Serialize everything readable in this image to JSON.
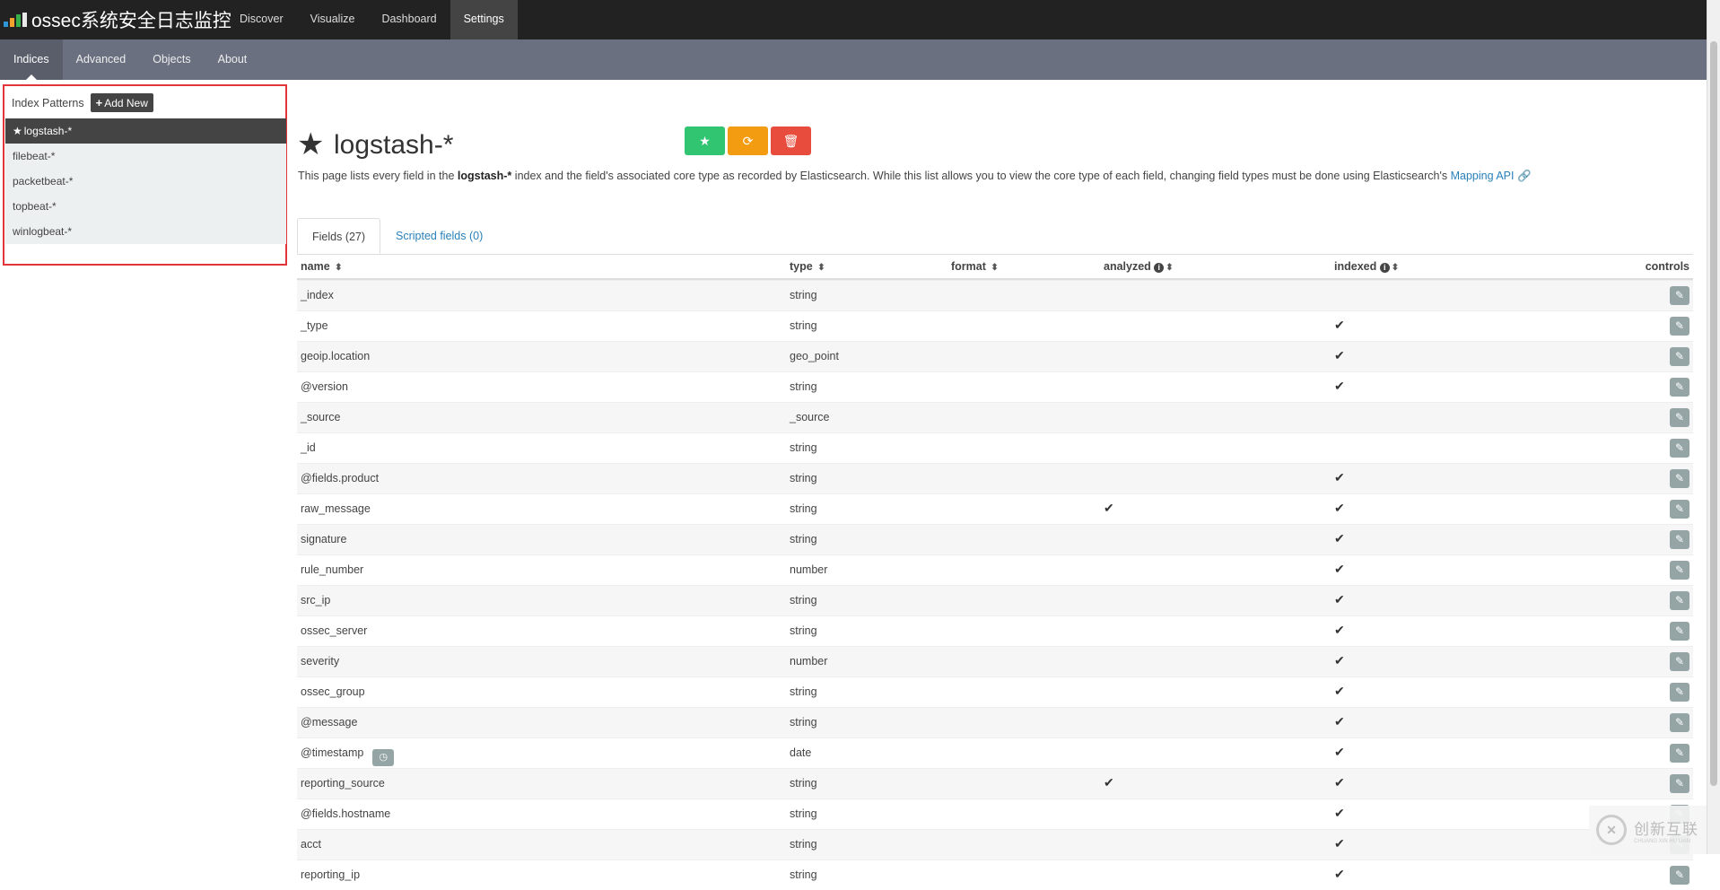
{
  "app": {
    "brand": "ossec系统安全日志监控",
    "logo_colors": [
      "#2f96d6",
      "#f2a22d",
      "#38b04a",
      "#e9e9e9"
    ]
  },
  "top_nav": [
    "Discover",
    "Visualize",
    "Dashboard",
    "Settings"
  ],
  "top_nav_active": "Settings",
  "sub_nav": [
    "Indices",
    "Advanced",
    "Objects",
    "About"
  ],
  "sub_nav_active": "Indices",
  "sidebar": {
    "title": "Index Patterns",
    "add_label": "Add New",
    "items": [
      "logstash-*",
      "filebeat-*",
      "packetbeat-*",
      "topbeat-*",
      "winlogbeat-*"
    ],
    "active_index": 0
  },
  "page": {
    "title": "logstash-*",
    "actions": [
      {
        "icon": "star-icon",
        "color": "#31c471"
      },
      {
        "icon": "refresh-icon",
        "color": "#f39c12"
      },
      {
        "icon": "trash-icon",
        "color": "#e74c3c"
      }
    ],
    "desc_prefix": "This page lists every field in the ",
    "desc_bold": "logstash-*",
    "desc_suffix": " index and the field's associated core type as recorded by Elasticsearch. While this list allows you to view the core type of each field, changing field types must be done using Elasticsearch's ",
    "desc_link": "Mapping API"
  },
  "tabs": {
    "fields": "Fields (27)",
    "scripted": "Scripted fields (0)"
  },
  "table": {
    "headers": {
      "name": "name",
      "type": "type",
      "format": "format",
      "analyzed": "analyzed",
      "indexed": "indexed",
      "controls": "controls"
    },
    "rows": [
      {
        "name": "_index",
        "type": "string",
        "analyzed": false,
        "indexed": false
      },
      {
        "name": "_type",
        "type": "string",
        "analyzed": false,
        "indexed": true
      },
      {
        "name": "geoip.location",
        "type": "geo_point",
        "analyzed": false,
        "indexed": true
      },
      {
        "name": "@version",
        "type": "string",
        "analyzed": false,
        "indexed": true
      },
      {
        "name": "_source",
        "type": "_source",
        "analyzed": false,
        "indexed": false
      },
      {
        "name": "_id",
        "type": "string",
        "analyzed": false,
        "indexed": false
      },
      {
        "name": "@fields.product",
        "type": "string",
        "analyzed": false,
        "indexed": true
      },
      {
        "name": "raw_message",
        "type": "string",
        "analyzed": true,
        "indexed": true
      },
      {
        "name": "signature",
        "type": "string",
        "analyzed": false,
        "indexed": true
      },
      {
        "name": "rule_number",
        "type": "number",
        "analyzed": false,
        "indexed": true
      },
      {
        "name": "src_ip",
        "type": "string",
        "analyzed": false,
        "indexed": true
      },
      {
        "name": "ossec_server",
        "type": "string",
        "analyzed": false,
        "indexed": true
      },
      {
        "name": "severity",
        "type": "number",
        "analyzed": false,
        "indexed": true
      },
      {
        "name": "ossec_group",
        "type": "string",
        "analyzed": false,
        "indexed": true
      },
      {
        "name": "@message",
        "type": "string",
        "analyzed": false,
        "indexed": true
      },
      {
        "name": "@timestamp",
        "type": "date",
        "analyzed": false,
        "indexed": true,
        "time_field": true
      },
      {
        "name": "reporting_source",
        "type": "string",
        "analyzed": true,
        "indexed": true
      },
      {
        "name": "@fields.hostname",
        "type": "string",
        "analyzed": false,
        "indexed": true
      },
      {
        "name": "acct",
        "type": "string",
        "analyzed": false,
        "indexed": true
      },
      {
        "name": "reporting_ip",
        "type": "string",
        "analyzed": false,
        "indexed": true
      }
    ]
  },
  "watermark": {
    "cn": "创新互联",
    "en": "CHUANG XIN HU LIAN"
  }
}
